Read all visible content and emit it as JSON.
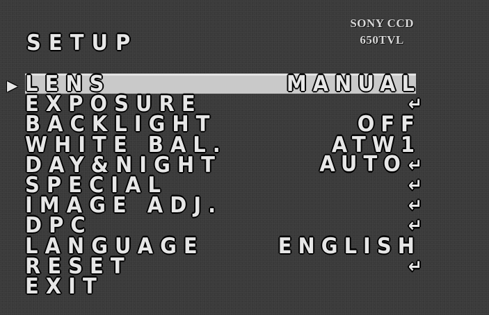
{
  "brand": {
    "line1": "SONY CCD",
    "line2": "650TVL"
  },
  "title": "SETUP",
  "cursor": "▶",
  "menu": {
    "items": [
      {
        "label": "LENS",
        "value": "MANUAL",
        "enter": ""
      },
      {
        "label": "EXPOSURE",
        "value": "",
        "enter": "↵"
      },
      {
        "label": "BACKLIGHT",
        "value": "OFF",
        "enter": ""
      },
      {
        "label": "WHITE BAL.",
        "value": "ATW1",
        "enter": ""
      },
      {
        "label": "DAY&NIGHT",
        "value": "AUTO",
        "enter": "↵"
      },
      {
        "label": "SPECIAL",
        "value": "",
        "enter": "↵"
      },
      {
        "label": "IMAGE ADJ.",
        "value": "",
        "enter": "↵"
      },
      {
        "label": "DPC",
        "value": "",
        "enter": "↵"
      },
      {
        "label": "LANGUAGE",
        "value": "ENGLISH",
        "enter": ""
      },
      {
        "label": "RESET",
        "value": "",
        "enter": "↵"
      },
      {
        "label": "EXIT",
        "value": "",
        "enter": ""
      }
    ],
    "selected_index": 0
  },
  "colors": {
    "background": "#3a3a3a",
    "text": "#e6e6e6",
    "highlight": "#c9c9c9"
  }
}
